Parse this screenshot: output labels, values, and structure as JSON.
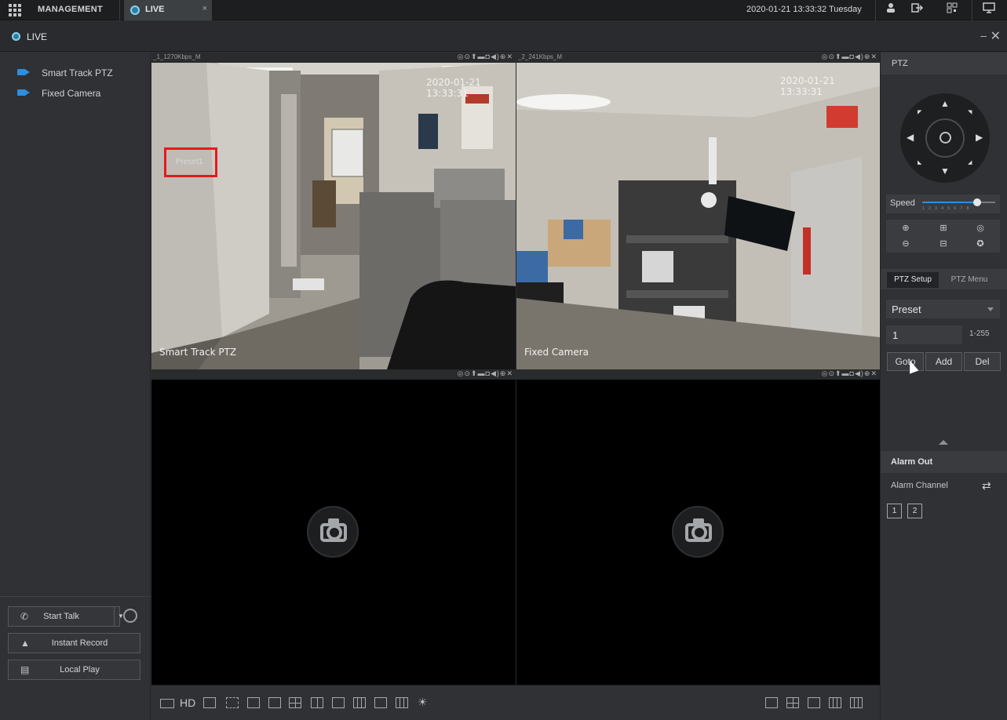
{
  "topbar": {
    "management_label": "MANAGEMENT",
    "tab_live_label": "LIVE",
    "tab_close": "×",
    "datetime": "2020-01-21 13:33:32 Tuesday"
  },
  "live_header": {
    "title": "LIVE",
    "minimize": "–",
    "close": "✕"
  },
  "device_tree": {
    "items": [
      {
        "label": "Smart Track PTZ"
      },
      {
        "label": "Fixed Camera"
      }
    ]
  },
  "left_actions": {
    "start_talk": "Start Talk",
    "instant_record": "Instant Record",
    "local_play": "Local Play"
  },
  "panes": {
    "p1": {
      "source": "_1_1270Kbps_M",
      "timestamp": "2020-01-21 13:33:31",
      "name": "Smart Track PTZ",
      "preset_overlay": "Preset1"
    },
    "p2": {
      "source": "_2_241Kbps_M",
      "timestamp": "2020-01-21 13:33:31",
      "name": "Fixed Camera"
    },
    "tools": "◎⊙⬆▬◘◀)⊕✕"
  },
  "bottom_toolbar": {
    "hd_label": "HD"
  },
  "ptz": {
    "header": "PTZ",
    "speed_label": "Speed",
    "speed_level": 6,
    "speed_max": 8,
    "speed_ticks": "12345678",
    "tabs": {
      "setup": "PTZ Setup",
      "menu": "PTZ Menu"
    },
    "function_selected": "Preset",
    "preset_value": "1",
    "preset_range": "1-255",
    "buttons": {
      "goto": "Goto",
      "add": "Add",
      "del": "Del"
    }
  },
  "alarm_out": {
    "header": "Alarm Out",
    "channel_label": "Alarm Channel",
    "channels": [
      "1",
      "2"
    ]
  }
}
